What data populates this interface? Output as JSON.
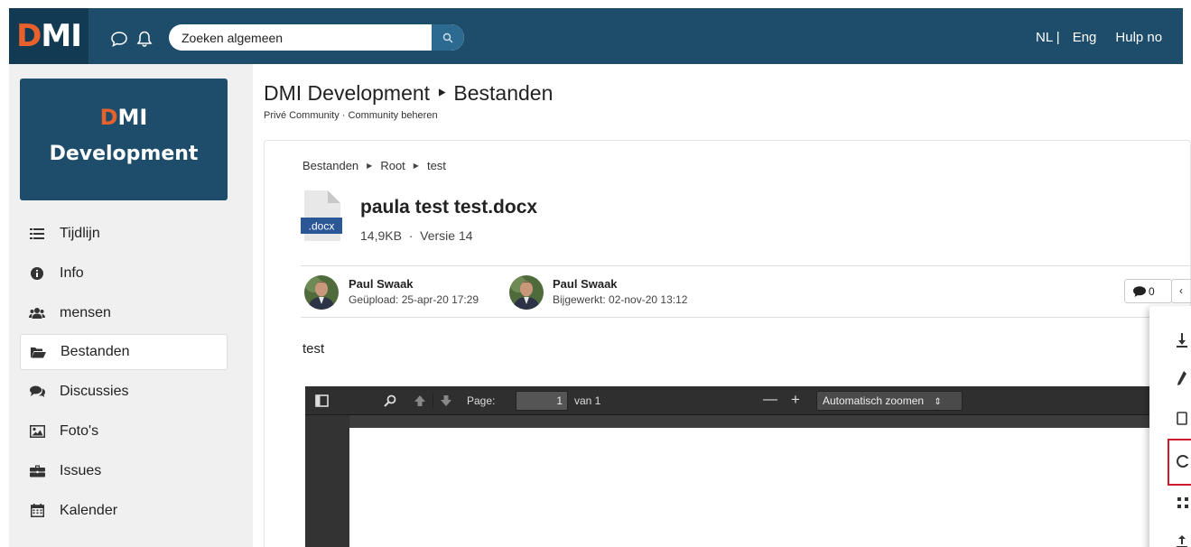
{
  "topbar": {
    "logo_d": "D",
    "logo_mi": "MI",
    "icons": [
      "chat-icon",
      "bell-icon",
      "search-icon"
    ],
    "search_placeholder": "Zoeken algemeen",
    "lang_nl": "NL |",
    "lang_en": "Eng",
    "help": "Hulp no"
  },
  "sidebar": {
    "brand_logo_d": "D",
    "brand_logo_mi": "MI",
    "brand_name": "Development",
    "items": [
      {
        "label": "Tijdlijn",
        "icon": "list-icon"
      },
      {
        "label": "Info",
        "icon": "info-icon"
      },
      {
        "label": "mensen",
        "icon": "users-icon"
      },
      {
        "label": "Bestanden",
        "icon": "folder-icon",
        "active": true
      },
      {
        "label": "Discussies",
        "icon": "comments-icon"
      },
      {
        "label": "Foto's",
        "icon": "image-icon"
      },
      {
        "label": "Issues",
        "icon": "briefcase-icon"
      },
      {
        "label": "Kalender",
        "icon": "calendar-icon"
      }
    ]
  },
  "page": {
    "title": "DMI Development ‣ Bestanden",
    "subtitle": "Privé Community · Community beheren"
  },
  "file": {
    "breadcrumb": [
      "Bestanden",
      "Root",
      "test"
    ],
    "ext_badge": ".docx",
    "name": "paula test test.docx",
    "meta": "14,9KB  ·  Versie 14",
    "uploader_name": "Paul Swaak",
    "uploaded": "Geüpload: 25-apr-20 17:29",
    "updater_name": "Paul Swaak",
    "updated": "Bijgewerkt: 02-nov-20 13:12",
    "comments_count": "0",
    "more_label": "‹",
    "description": "test"
  },
  "viewer": {
    "page_label": "Page:",
    "page_value": "1",
    "page_total": "van 1",
    "minus": "—",
    "plus": "+",
    "zoom": "Automatisch zoomen"
  }
}
